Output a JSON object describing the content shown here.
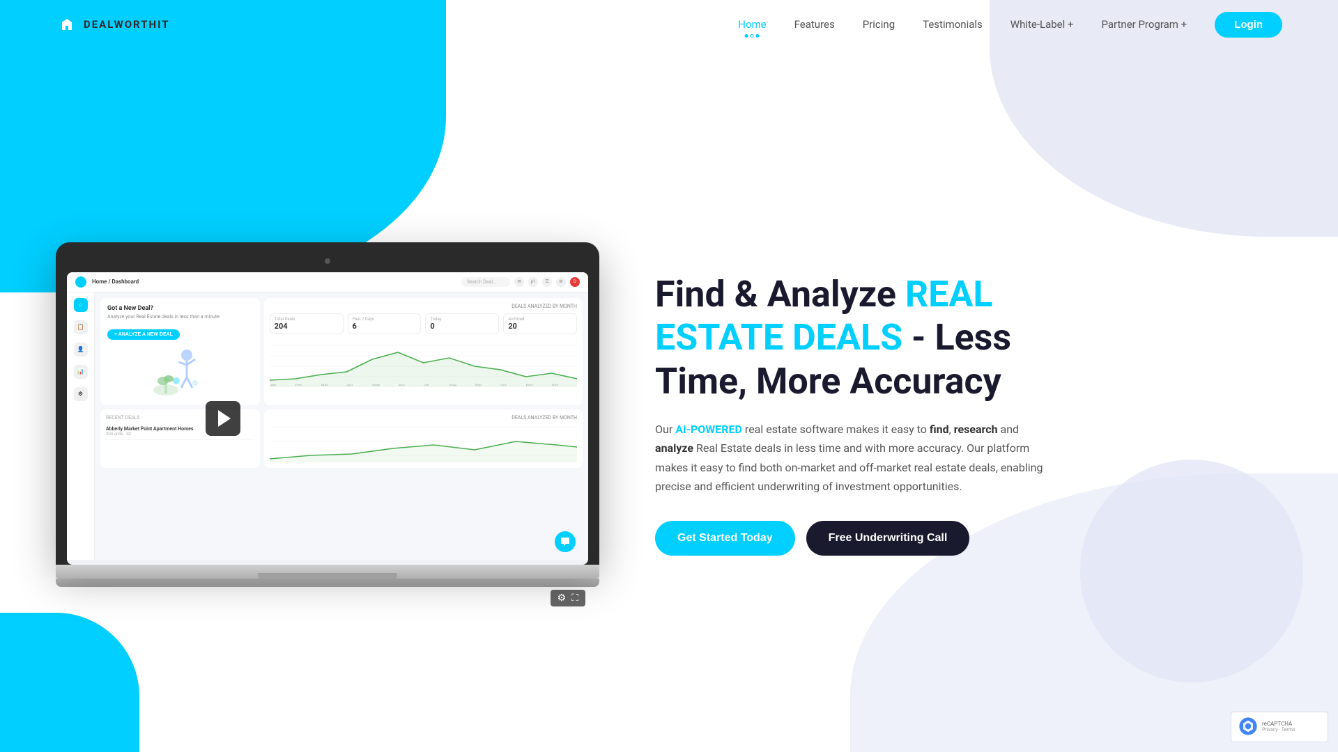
{
  "nav": {
    "logo_text": "DEALWORTHIT",
    "links": [
      {
        "label": "Home",
        "active": true,
        "id": "home"
      },
      {
        "label": "Features",
        "active": false,
        "id": "features"
      },
      {
        "label": "Pricing",
        "active": false,
        "id": "pricing"
      },
      {
        "label": "Testimonials",
        "active": false,
        "id": "testimonials"
      },
      {
        "label": "White-Label +",
        "active": false,
        "id": "white-label"
      },
      {
        "label": "Partner Program +",
        "active": false,
        "id": "partner-program"
      }
    ],
    "login_label": "Login"
  },
  "hero": {
    "title_part1": "Find & Analyze ",
    "title_accent": "REAL ESTATE DEALS",
    "title_part2": " - Less Time, More Accuracy",
    "description_prefix": "Our ",
    "description_accent": "AI-POWERED",
    "description_body": " real estate software makes it easy to ",
    "description_find": "find",
    "description_comma": ", ",
    "description_research": "research",
    "description_and": " and ",
    "description_analyze": "analyze",
    "description_rest": " Real Estate deals in less time and with more accuracy. Our platform makes it easy to find both on-market and off-market real estate deals, enabling precise and efficient underwriting of investment opportunities.",
    "cta_primary": "Get Started Today",
    "cta_secondary": "Free Underwriting Call"
  },
  "screen": {
    "breadcrumb_home": "Home",
    "breadcrumb_sep": " / ",
    "breadcrumb_current": "Dashboard",
    "search_placeholder": "Search Deal...",
    "stat1_label": "Total Deals",
    "stat1_value": "204",
    "stat2_label": "Past 7 Days",
    "stat2_value": "6",
    "stat3_label": "Today",
    "stat3_value": "0",
    "stat4_label": "Archived",
    "stat4_value": "20",
    "chart_label": "DEALS ANALYZED BY MONTH",
    "new_deal_title": "Got a New Deal?",
    "new_deal_subtitle": "Analyze your Real Estate deals in less than a minute",
    "analyze_btn": "+ ANALYZE A NEW DEAL",
    "recent_title": "RECENT DEALS",
    "deal1_name": "Abberly Market Point Apartment Homes",
    "deal1_sub": "204 units · SC"
  },
  "controls": {
    "settings_icon": "⚙",
    "fullscreen_icon": "⛶"
  },
  "recaptcha": {
    "label": "reCAPTCHA",
    "privacy": "Privacy",
    "terms": "Terms"
  }
}
